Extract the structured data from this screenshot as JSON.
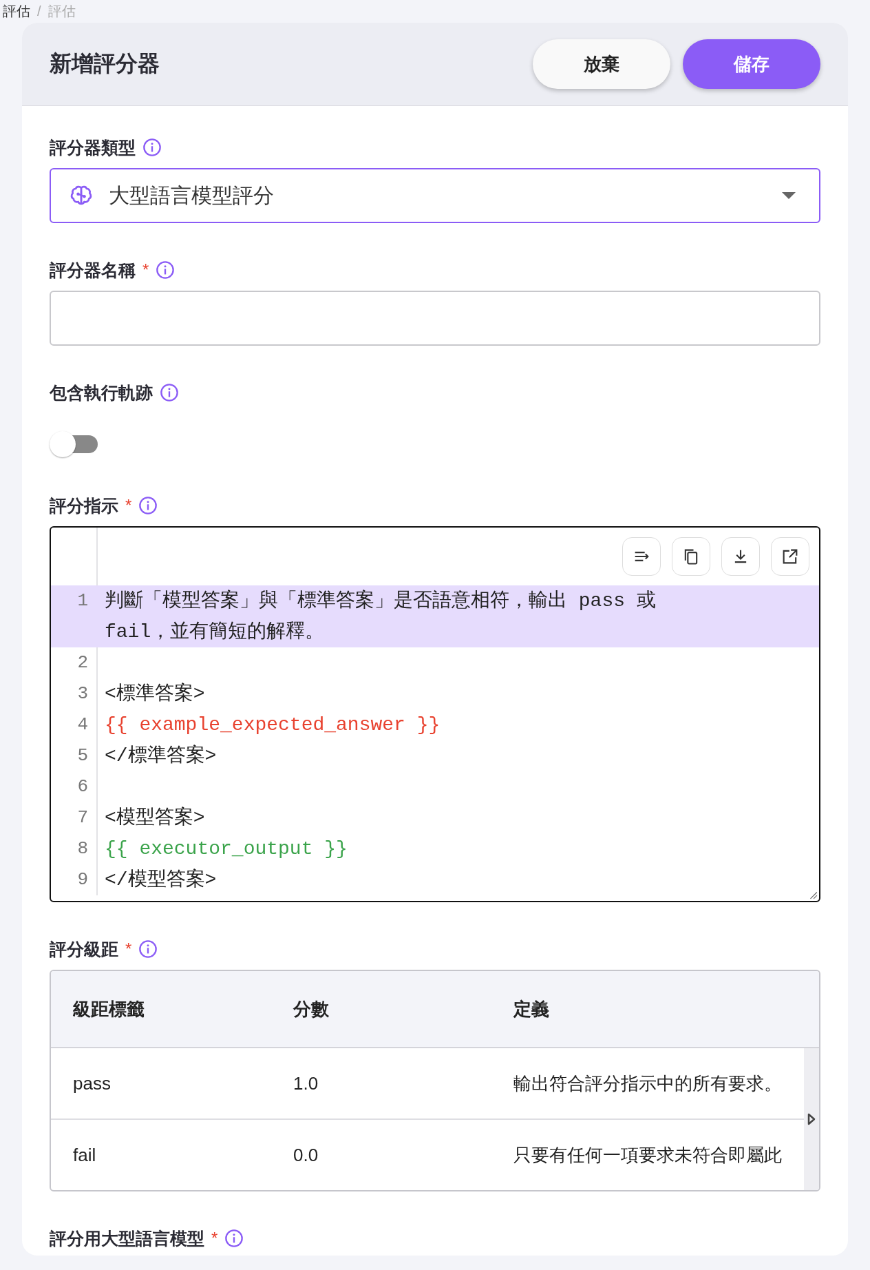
{
  "breadcrumb": [
    "評估",
    "/",
    "評估"
  ],
  "header": {
    "title": "新增評分器",
    "buttons": [
      {
        "label": "放棄",
        "kind": "secondary"
      },
      {
        "label": "儲存",
        "kind": "primary"
      }
    ]
  },
  "evaluator_type": {
    "label": "評分器類型",
    "value": "大型語言模型評分"
  },
  "evaluator_name": {
    "label": "評分器名稱",
    "required_mark": "*"
  },
  "include_trace": {
    "label": "包含執行軌跡",
    "on": false
  },
  "instructions": {
    "label": "評分指示",
    "required_mark": "*",
    "lines": [
      {
        "number": "1",
        "text": "判斷「模型答案」與「標準答案」是否語意相符，輸出 pass 或 fail，並有簡短的解釋。",
        "selected": true
      },
      {
        "number": "2",
        "selected": false
      },
      {
        "number": "3",
        "text": "<標準答案>",
        "selected": false
      },
      {
        "number": "4",
        "text": "{{ example_expected_answer }}",
        "selected": false,
        "color": "#e8412e"
      },
      {
        "number": "5",
        "text": "</標準答案>",
        "selected": false
      },
      {
        "number": "6",
        "selected": false
      },
      {
        "number": "7",
        "text": "<模型答案>",
        "selected": false
      },
      {
        "number": "8",
        "text": "{{ executor_output }}",
        "selected": false,
        "color": "#3aa34a"
      },
      {
        "number": "9",
        "text": "</模型答案>",
        "selected": false
      }
    ]
  },
  "scale": {
    "label": "評分級距",
    "required_mark": "*",
    "table": {
      "columns": [
        "級距標籤",
        "分數",
        "定義"
      ],
      "rows": [
        [
          "pass",
          "1.0",
          "輸出符合評分指示中的所有要求。"
        ],
        [
          "fail",
          "0.0",
          "只要有任何一項要求未符合即屬此"
        ]
      ]
    }
  },
  "model": {
    "label": "評分用大型語言模型",
    "required_mark": "*"
  }
}
